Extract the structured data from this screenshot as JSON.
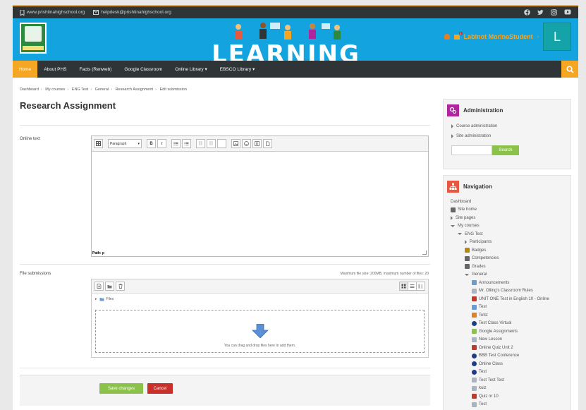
{
  "topbar": {
    "website": "www.prishtinahighschool.org",
    "email": "helpdesk@prishtinahighschool.org",
    "social": [
      "facebook-icon",
      "twitter-icon",
      "instagram-icon",
      "youtube-icon"
    ]
  },
  "header": {
    "banner_word": "LEARNING",
    "user_name": "Labinot MorinaStudent",
    "avatar_letter": "L",
    "notification_count": "1"
  },
  "navbar": {
    "items": [
      {
        "label": "Home",
        "active": true
      },
      {
        "label": "About PHS",
        "active": false
      },
      {
        "label": "Facts (Renweb)",
        "active": false
      },
      {
        "label": "Google Classroom",
        "active": false
      },
      {
        "label": "Online Library ▾",
        "active": false
      },
      {
        "label": "EBSCO Library ▾",
        "active": false
      }
    ]
  },
  "breadcrumb": [
    "Dashboard",
    "My courses",
    "ENG Test",
    "General",
    "Research Assignment",
    "Edit submission"
  ],
  "main": {
    "title": "Research Assignment",
    "online_text_label": "Online text",
    "editor_format": "Paragraph",
    "editor_path": "Path: p",
    "file_submissions_label": "File submissions",
    "max_size_text": "Maximum file size: 200MB, maximum number of files: 20",
    "files_folder": "Files",
    "drop_text": "You can drag and drop files here to add them.",
    "save_label": "Save changes",
    "cancel_label": "Cancel"
  },
  "admin_block": {
    "title": "Administration",
    "links": [
      "Course administration",
      "Site administration"
    ],
    "search_label": "Search"
  },
  "nav_block": {
    "title": "Navigation",
    "items": [
      {
        "label": "Dashboard",
        "icon": "none"
      },
      {
        "label": "Site home",
        "icon": "home-icon"
      },
      {
        "label": "Site pages",
        "icon": "collapsed"
      },
      {
        "label": "My courses",
        "icon": "expanded"
      },
      {
        "label": "ENG Test",
        "icon": "expanded"
      },
      {
        "label": "Participants",
        "icon": "collapsed"
      },
      {
        "label": "Badges",
        "icon": "trophy-icon"
      },
      {
        "label": "Competencies",
        "icon": "checklist-icon"
      },
      {
        "label": "Grades",
        "icon": "table-icon"
      },
      {
        "label": "General",
        "icon": "expanded"
      },
      {
        "label": "Announcements",
        "icon": "forum-icon"
      },
      {
        "label": "Mr. Olling's Classroom Rules",
        "icon": "page-icon"
      },
      {
        "label": "UNIT ONE Test in English 10 - Online",
        "icon": "quiz-icon"
      },
      {
        "label": "Test",
        "icon": "attendance-icon"
      },
      {
        "label": "Tetst",
        "icon": "game-icon"
      },
      {
        "label": "Test Class Virtual",
        "icon": "bbb-icon"
      },
      {
        "label": "Google Assignments",
        "icon": "puzzle-icon"
      },
      {
        "label": "New Lesson",
        "icon": "page-icon"
      },
      {
        "label": "Online Quiz Unit 2",
        "icon": "quiz-icon"
      },
      {
        "label": "BBB Test Conference",
        "icon": "bbb-icon"
      },
      {
        "label": "Online Class",
        "icon": "bbb-icon"
      },
      {
        "label": "Test",
        "icon": "bbb-icon"
      },
      {
        "label": "Test Test Test",
        "icon": "page-icon"
      },
      {
        "label": "kuiz",
        "icon": "page-icon"
      },
      {
        "label": "Quiz nr 10",
        "icon": "quiz-icon"
      },
      {
        "label": "Test",
        "icon": "page-icon"
      }
    ]
  },
  "colors": {
    "accent": "#f5a623",
    "header_blue": "#13a3de",
    "dark_bar": "#2f3436",
    "green_button": "#8bc34a",
    "red_button": "#c9302c"
  }
}
